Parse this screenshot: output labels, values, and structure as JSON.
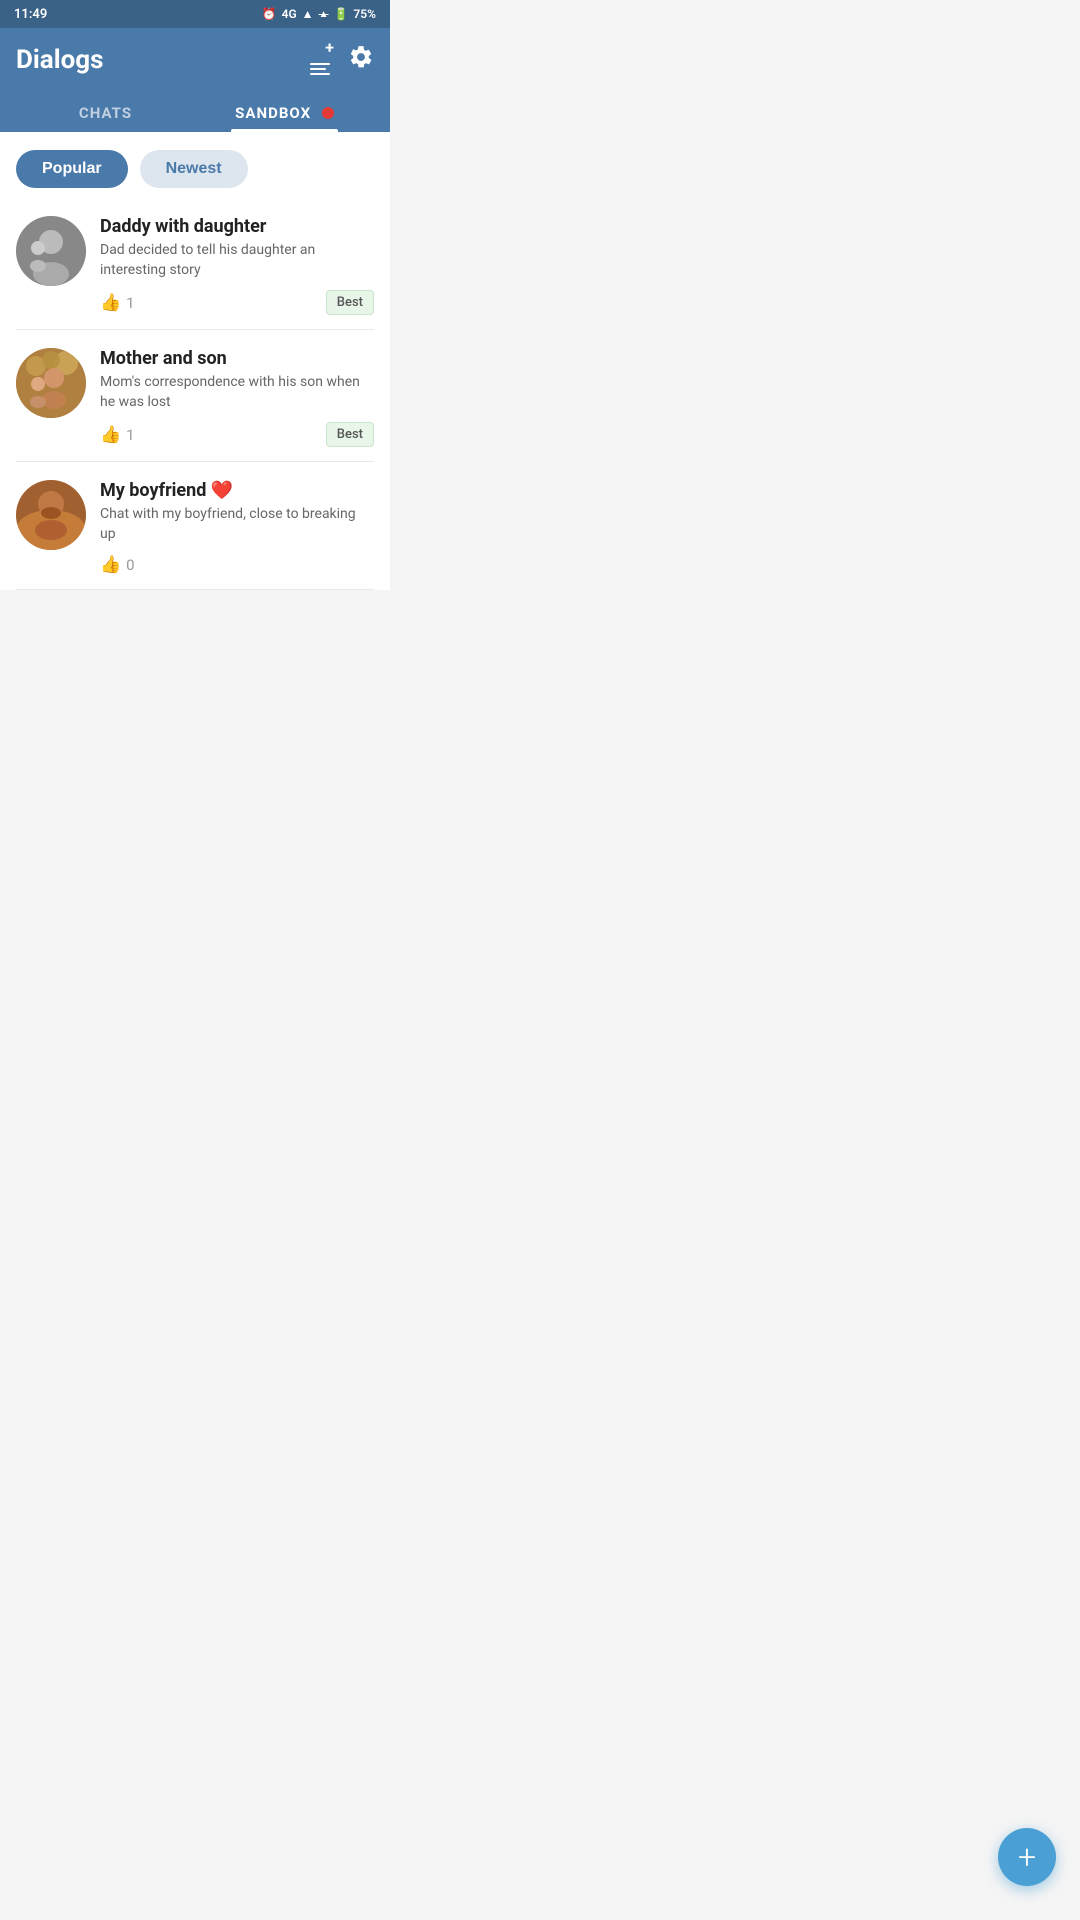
{
  "statusBar": {
    "time": "11:49",
    "signal": "4G",
    "battery": "75%"
  },
  "header": {
    "title": "Dialogs",
    "newChatLabel": "New Chat",
    "settingsLabel": "Settings"
  },
  "tabs": [
    {
      "id": "chats",
      "label": "CHATS",
      "active": false
    },
    {
      "id": "sandbox",
      "label": "SANDBOX",
      "active": true,
      "badge": true
    }
  ],
  "filters": [
    {
      "id": "popular",
      "label": "Popular",
      "active": true
    },
    {
      "id": "newest",
      "label": "Newest",
      "active": false
    }
  ],
  "chats": [
    {
      "id": "daddy-daughter",
      "name": "Daddy with daughter",
      "description": "Dad decided to tell his daughter an interesting story",
      "likes": 1,
      "badge": "Best",
      "avatarClass": "avatar-1"
    },
    {
      "id": "mother-son",
      "name": "Mother and son",
      "description": "Mom's correspondence with his son when he was lost",
      "likes": 1,
      "badge": "Best",
      "avatarClass": "avatar-2"
    },
    {
      "id": "my-boyfriend",
      "name": "My boyfriend",
      "nameEmoji": "❤️",
      "description": "Chat with my boyfriend, close to breaking up",
      "likes": 0,
      "badge": null,
      "avatarClass": "avatar-3"
    }
  ],
  "fab": {
    "label": "+"
  }
}
